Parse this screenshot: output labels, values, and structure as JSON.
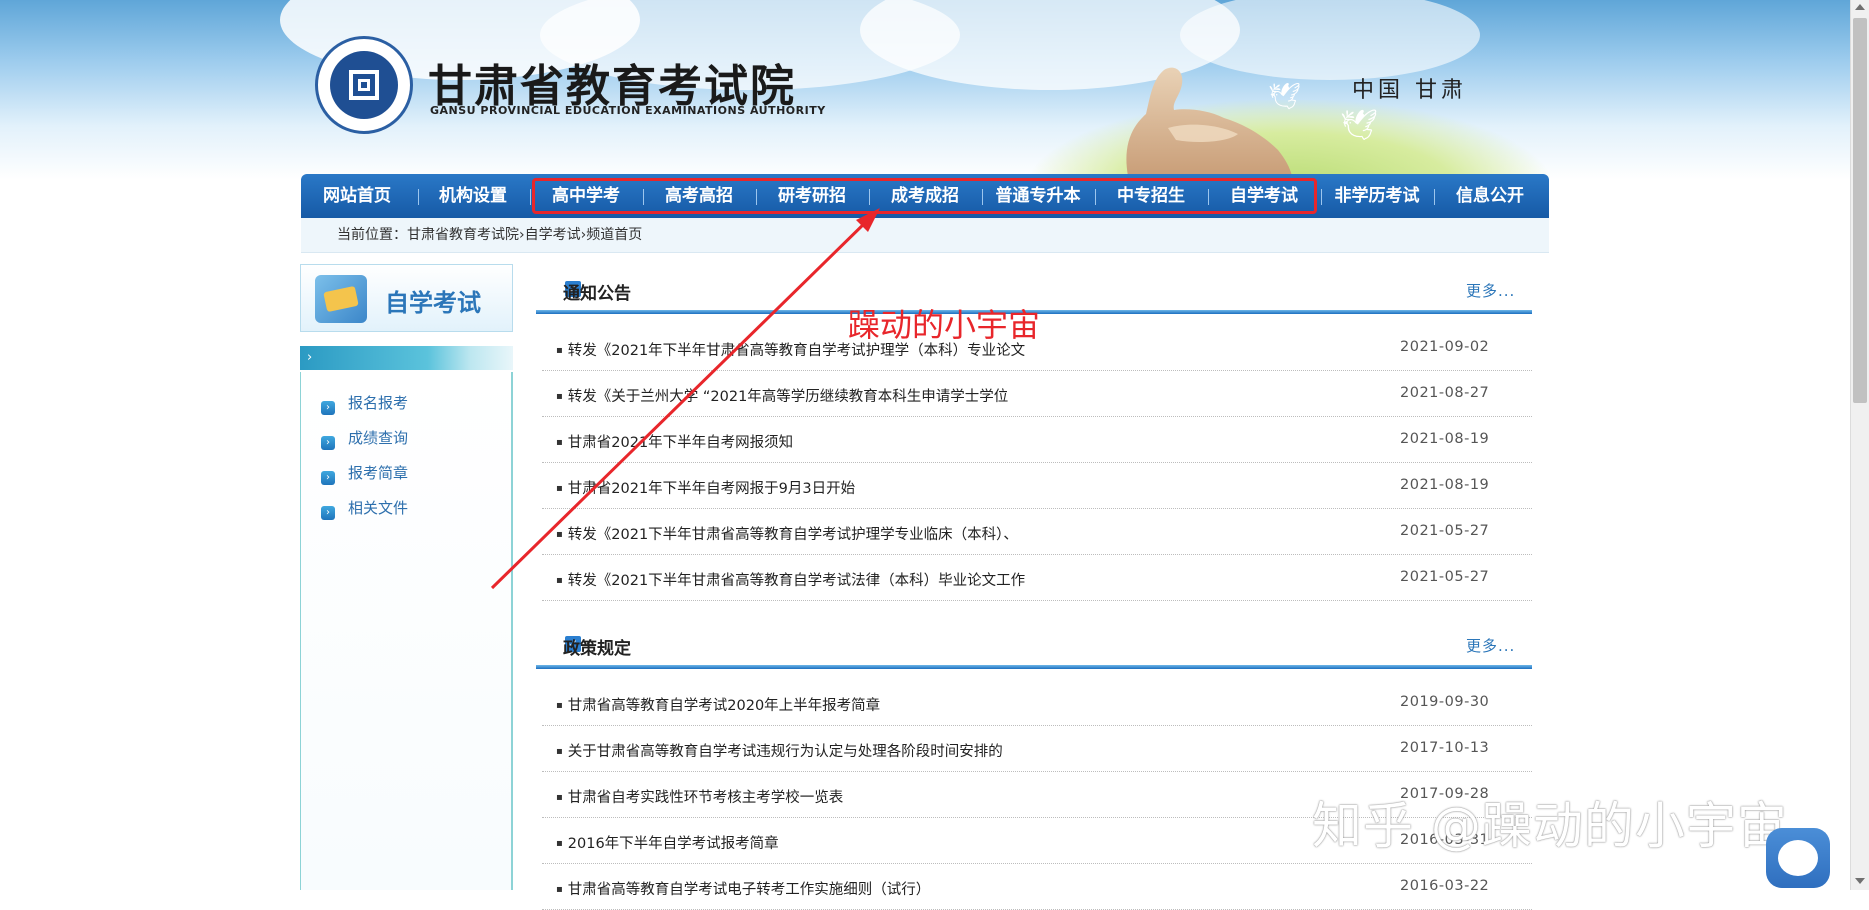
{
  "header": {
    "site_name": "甘肃省教育考试院",
    "site_name_en": "GANSU PROVINCIAL EDUCATION EXAMINATIONS AUTHORITY",
    "region": "中国 甘肃"
  },
  "nav": {
    "items": [
      {
        "label": "网站首页"
      },
      {
        "label": "机构设置"
      },
      {
        "label": "高中学考"
      },
      {
        "label": "高考高招"
      },
      {
        "label": "研考研招"
      },
      {
        "label": "成考成招"
      },
      {
        "label": "普通专升本"
      },
      {
        "label": "中专招生"
      },
      {
        "label": "自学考试"
      },
      {
        "label": "非学历考试"
      },
      {
        "label": "信息公开"
      }
    ]
  },
  "breadcrumb": {
    "text": "当前位置：甘肃省教育考试院›自学考试›频道首页"
  },
  "sidebar": {
    "title": "自学考试",
    "items": [
      {
        "label": "报名报考"
      },
      {
        "label": "成绩查询"
      },
      {
        "label": "报考简章"
      },
      {
        "label": "相关文件"
      }
    ]
  },
  "sections": [
    {
      "title": "通知公告",
      "more": "更多...",
      "rows": [
        {
          "title": "转发《2021年下半年甘肃省高等教育自学考试护理学（本科）专业论文",
          "date": "2021-09-02"
        },
        {
          "title": "转发《关于兰州大学 “2021年高等学历继续教育本科生申请学士学位",
          "date": "2021-08-27"
        },
        {
          "title": "甘肃省2021年下半年自考网报须知",
          "date": "2021-08-19"
        },
        {
          "title": "甘肃省2021年下半年自考网报于9月3日开始",
          "date": "2021-08-19"
        },
        {
          "title": "转发《2021下半年甘肃省高等教育自学考试护理学专业临床（本科）、",
          "date": "2021-05-27"
        },
        {
          "title": "转发《2021下半年甘肃省高等教育自学考试法律（本科）毕业论文工作",
          "date": "2021-05-27"
        }
      ]
    },
    {
      "title": "政策规定",
      "more": "更多...",
      "rows": [
        {
          "title": "甘肃省高等教育自学考试2020年上半年报考简章",
          "date": "2019-09-30"
        },
        {
          "title": "关于甘肃省高等教育自学考试违规行为认定与处理各阶段时间安排的",
          "date": "2017-10-13"
        },
        {
          "title": "甘肃省自考实践性环节考核主考学校一览表",
          "date": "2017-09-28"
        },
        {
          "title": "2016年下半年自学考试报考简章",
          "date": "2016-03-31"
        },
        {
          "title": "甘肃省高等教育自学考试电子转考工作实施细则（试行）",
          "date": "2016-03-22"
        }
      ]
    }
  ],
  "annotation": {
    "label": "躁动的小宇宙",
    "color": "#e8262b"
  },
  "watermark": {
    "text": "知乎 @躁动的小宇宙"
  },
  "colors": {
    "nav_bg": "#1d65b3",
    "accent": "#2b76b9",
    "highlight": "#e8262b"
  }
}
